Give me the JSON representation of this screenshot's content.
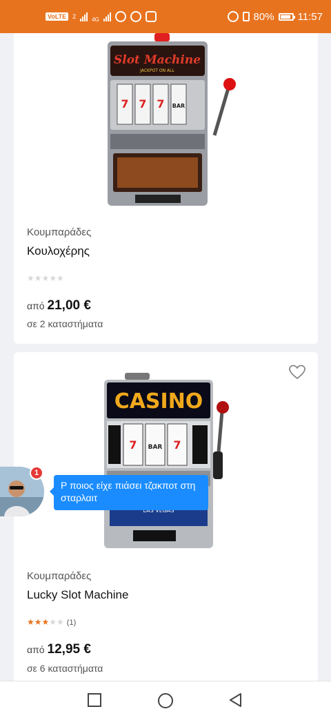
{
  "status_bar": {
    "network_label": "VoLTE",
    "sim_badge": "2",
    "net_gen": "4G",
    "battery": "80%",
    "time": "11:57"
  },
  "products": [
    {
      "category": "Κουμπαράδες",
      "title": "Κουλοχέρης",
      "rating": 0,
      "review_count": "",
      "price_prefix": "από",
      "price": "21,00 €",
      "stores": "σε 2 καταστήματα",
      "image_text": "Slot Machine",
      "image_subtext": "JACKPOT ON ALL"
    },
    {
      "category": "Κουμπαράδες",
      "title": "Lucky Slot Machine",
      "rating": 3,
      "review_count": "(1)",
      "price_prefix": "από",
      "price": "12,95 €",
      "stores": "σε 6 καταστήματα",
      "image_text": "CASINO",
      "image_subtext": "LAS VEGAS"
    }
  ],
  "chat_head": {
    "badge_count": "1",
    "message": "Ρ ποιος είχε πιάσει τζακποτ στη σταρλαιτ"
  },
  "nav_bar": {
    "icons": [
      "recents-square-icon",
      "home-circle-icon",
      "back-triangle-icon"
    ]
  },
  "colors": {
    "status_bar": "#e8731f",
    "accent": "#e8731f",
    "chat_bubble": "#1a8cff",
    "badge": "#e53935"
  }
}
